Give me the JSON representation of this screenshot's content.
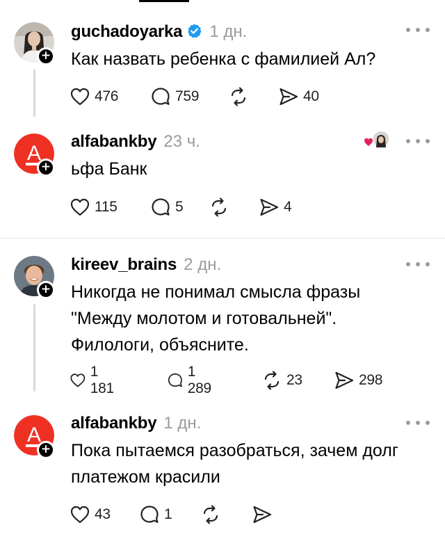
{
  "posts": [
    {
      "username": "guchadoyarka",
      "verified": true,
      "time": "1 дн.",
      "text": "Как назвать ребенка с фамилией Ал?",
      "likes": "476",
      "replies": "759",
      "reposts": "",
      "shares": "40",
      "avatar": "woman-photo"
    },
    {
      "username": "alfabankby",
      "verified": false,
      "time": "23 ч.",
      "text": "ьфа Банк",
      "likes": "115",
      "replies": "5",
      "reposts": "",
      "shares": "4",
      "avatar": "alfa-logo",
      "liked_by_author": true
    },
    {
      "username": "kireev_brains",
      "verified": false,
      "time": "2 дн.",
      "text_lines": [
        "Никогда не понимал смысла фразы",
        "\"Между молотом и готовальней\".",
        "Филологи, объясните."
      ],
      "likes": "1 181",
      "replies": "1 289",
      "reposts": "23",
      "shares": "298",
      "avatar": "man-photo"
    },
    {
      "username": "alfabankby",
      "verified": false,
      "time": "1 дн.",
      "text_lines": [
        "Пока пытаемся разобраться, зачем долг",
        "платежом красили"
      ],
      "likes": "43",
      "replies": "1",
      "reposts": "",
      "shares": "",
      "avatar": "alfa-logo"
    }
  ],
  "colors": {
    "alfa_red": "#ef3124",
    "verified_blue": "#1d9bf0",
    "muted": "#9a9a9a",
    "like_heart": "#e0245e"
  },
  "badge_symbol": "+",
  "logo_letter": "A"
}
